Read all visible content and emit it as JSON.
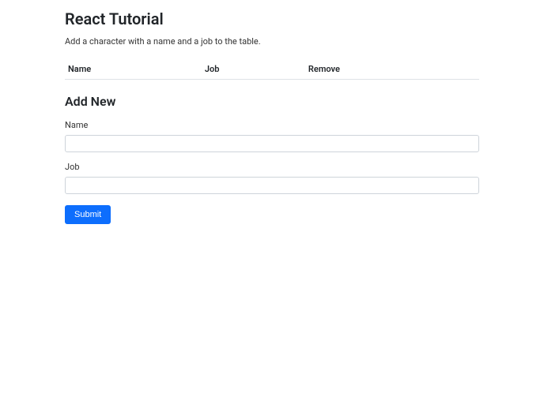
{
  "header": {
    "title": "React Tutorial",
    "subtitle": "Add a character with a name and a job to the table."
  },
  "table": {
    "columns": [
      "Name",
      "Job",
      "Remove"
    ]
  },
  "form": {
    "heading": "Add New",
    "name_label": "Name",
    "name_value": "",
    "job_label": "Job",
    "job_value": "",
    "submit_label": "Submit"
  }
}
